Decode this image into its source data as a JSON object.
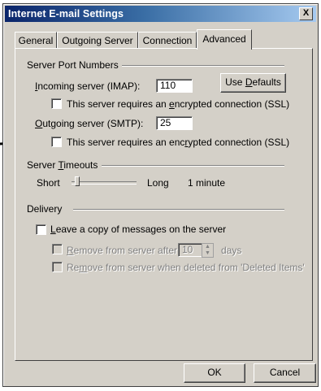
{
  "window": {
    "title": "Internet E-mail Settings",
    "close_glyph": "X"
  },
  "tabs": [
    {
      "label": "General",
      "active": false
    },
    {
      "label": "Outgoing Server",
      "active": false
    },
    {
      "label": "Connection",
      "active": false
    },
    {
      "label": "Advanced",
      "active": true
    }
  ],
  "server_ports": {
    "heading": "Server Port Numbers",
    "incoming_label_pre": "",
    "incoming_label_u": "I",
    "incoming_label_post": "ncoming server (IMAP):",
    "incoming_value": "110",
    "use_defaults_pre": "Use ",
    "use_defaults_u": "D",
    "use_defaults_post": "efaults",
    "incoming_ssl_pre": "This server requires an ",
    "incoming_ssl_u": "e",
    "incoming_ssl_post": "ncrypted connection (SSL)",
    "incoming_ssl_checked": false,
    "outgoing_label_pre": "",
    "outgoing_label_u": "O",
    "outgoing_label_post": "utgoing server (SMTP):",
    "outgoing_value": "25",
    "outgoing_ssl_pre": "This server requires an enc",
    "outgoing_ssl_u": "r",
    "outgoing_ssl_post": "ypted connection (SSL)",
    "outgoing_ssl_checked": false
  },
  "timeouts": {
    "heading_pre": "Server ",
    "heading_u": "T",
    "heading_post": "imeouts",
    "short_label": "Short",
    "long_label": "Long",
    "value_text": "1 minute",
    "slider_level": 0.1
  },
  "delivery": {
    "heading": "Delivery",
    "leave_copy_pre": "",
    "leave_copy_u": "L",
    "leave_copy_post": "eave a copy of messages on the server",
    "leave_copy_checked": false,
    "remove_after_pre": "",
    "remove_after_u": "R",
    "remove_after_post": "emove from server after",
    "remove_after_days_value": "10",
    "days_label": "days",
    "remove_deleted_pre": "Re",
    "remove_deleted_u": "m",
    "remove_deleted_post": "ove from server when deleted from 'Deleted Items'"
  },
  "buttons": {
    "ok": "OK",
    "cancel": "Cancel"
  },
  "colors": {
    "dialog_bg": "#d4d0c8",
    "title_gradient_start": "#0a246a",
    "title_gradient_end": "#a6caf0",
    "annotation_arrow": "#000000"
  }
}
